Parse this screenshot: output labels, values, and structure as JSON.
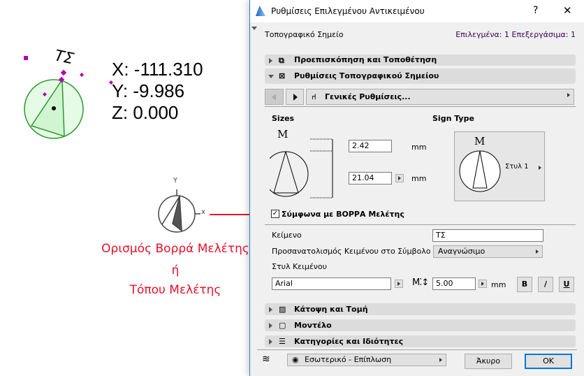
{
  "drawing": {
    "point_label": "ΤΣ",
    "x": "X: -111.310",
    "y": "Y: -9.986",
    "z": "Z: 0.000",
    "axis_y": "Y",
    "axis_x": "x",
    "caption_line1": "Ορισμός Βορρά Μελέτης",
    "caption_line2": "ή",
    "caption_line3": "Τόπου Μελέτης",
    "accent_red": "#e8102a",
    "point_green": "#2a9a2a"
  },
  "dialog": {
    "title": "Ρυθμίσεις Επιλεγμένου Αντικειμένου",
    "help": "?",
    "close": "✕",
    "object_type": "Τοπογραφικό Σημείο",
    "selection_info": "Επιλεγμένα: 1 Επεξεργάσιμα: 1",
    "panels": {
      "preview": "Προεπισκόπηση και Τοποθέτηση",
      "settings": "Ρυθμίσεις Τοπογραφικού Σημείου",
      "plan": "Κάτοψη και Τομή",
      "model": "Μοντέλο",
      "categories": "Κατηγορίες και Ιδιότητες"
    },
    "page_select": "Γενικές Ρυθμίσεις...",
    "sizes_label": "Sizes",
    "sign_type_label": "Sign Type",
    "preview_letter": "M",
    "size1": "2.42",
    "size2": "21.04",
    "unit": "mm",
    "sign_style": "Στυλ 1",
    "north_checkbox": "Σύμφωνα με ΒΟΡΡΑ Μελέτης",
    "north_checked": true,
    "text_label": "Κείμενο",
    "text_value": "ΤΣ",
    "orientation_label": "Προσανατολισμός Κειμένου στο Σύμβολο",
    "orientation_value": "Αναγνώσιμο",
    "text_style_label": "Στυλ Κειμένου",
    "font": "Arial",
    "font_size": "5.00",
    "bold": "B",
    "italic": "/",
    "underline": "U",
    "layer": "Εσωτερικό - Επίπλωση",
    "cancel": "Άκυρο",
    "ok": "OK"
  }
}
